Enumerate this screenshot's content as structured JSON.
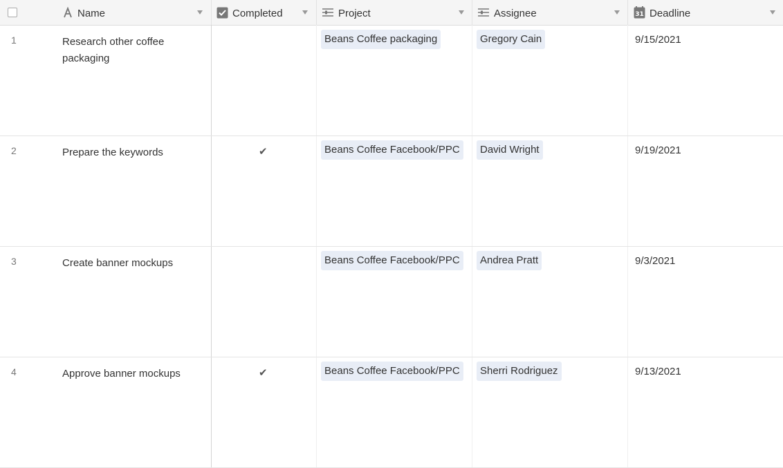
{
  "header": {
    "columns": [
      {
        "label": "Name",
        "icon": "text-type-icon"
      },
      {
        "label": "Completed",
        "icon": "checkbox-field-icon"
      },
      {
        "label": "Project",
        "icon": "link-field-icon"
      },
      {
        "label": "Assignee",
        "icon": "link-field-icon"
      },
      {
        "label": "Deadline",
        "icon": "calendar-icon",
        "icon_text": "31"
      }
    ]
  },
  "rows": [
    {
      "num": "1",
      "name": "Research other coffee packaging",
      "completed": false,
      "check": "",
      "project": "Beans Coffee packaging",
      "assignee": "Gregory Cain",
      "deadline": "9/15/2021"
    },
    {
      "num": "2",
      "name": "Prepare the keywords",
      "completed": true,
      "check": "✔",
      "project": "Beans Coffee Facebook/PPC",
      "assignee": "David Wright",
      "deadline": "9/19/2021"
    },
    {
      "num": "3",
      "name": "Create banner mockups",
      "completed": false,
      "check": "",
      "project": "Beans Coffee Facebook/PPC",
      "assignee": "Andrea Pratt",
      "deadline": "9/3/2021"
    },
    {
      "num": "4",
      "name": "Approve banner mockups",
      "completed": true,
      "check": "✔",
      "project": "Beans Coffee Facebook/PPC",
      "assignee": "Sherri Rodriguez",
      "deadline": "9/13/2021"
    }
  ],
  "colors": {
    "header_bg": "#f5f5f5",
    "pill_bg": "#e8edf6",
    "text": "#333333",
    "muted": "#777777"
  }
}
